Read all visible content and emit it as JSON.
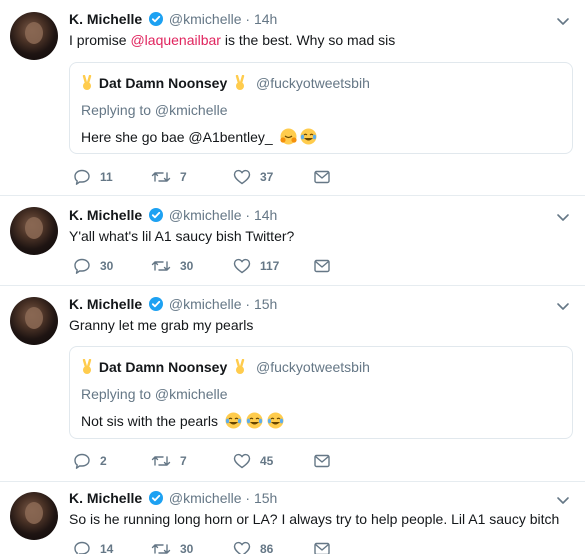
{
  "tweets": [
    {
      "name": "K. Michelle",
      "handle": "@kmichelle",
      "dot": "·",
      "time": "14h",
      "text_before": "I promise ",
      "mention": "@laquenailbar",
      "text_after": " is the best. Why so mad sis",
      "quote": {
        "name": "Dat Damn Noonsey",
        "handle": "@fuckyotweetsbih",
        "replying": "Replying to @kmichelle",
        "text": "Here she go bae @A1bentley_"
      },
      "replies": "11",
      "retweets": "7",
      "likes": "37"
    },
    {
      "name": "K. Michelle",
      "handle": "@kmichelle",
      "dot": "·",
      "time": "14h",
      "text": "Y'all what's lil A1 saucy bish Twitter?",
      "replies": "30",
      "retweets": "30",
      "likes": "117"
    },
    {
      "name": "K. Michelle",
      "handle": "@kmichelle",
      "dot": "·",
      "time": "15h",
      "text": "Granny let me grab my pearls",
      "quote": {
        "name": "Dat Damn Noonsey",
        "handle": "@fuckyotweetsbih",
        "replying": "Replying to @kmichelle",
        "text": "Not sis with the pearls"
      },
      "replies": "2",
      "retweets": "7",
      "likes": "45"
    },
    {
      "name": "K. Michelle",
      "handle": "@kmichelle",
      "dot": "·",
      "time": "15h",
      "text": "So is he running long horn or LA? I always try to help people. Lil A1 saucy bitch",
      "replies": "14",
      "retweets": "30",
      "likes": "86"
    }
  ],
  "colors": {
    "mention": "#e0245e",
    "secondary": "#657786",
    "verified": "#1da1f2",
    "border": "#e6ecf0",
    "emoji": "#ffcc4d"
  },
  "icons": [
    "verified-badge-icon",
    "chevron-down-icon",
    "reply-icon",
    "retweet-icon",
    "like-heart-icon",
    "direct-message-icon",
    "victory-hand-emoji",
    "hugging-face-emoji",
    "tears-of-joy-emoji"
  ]
}
